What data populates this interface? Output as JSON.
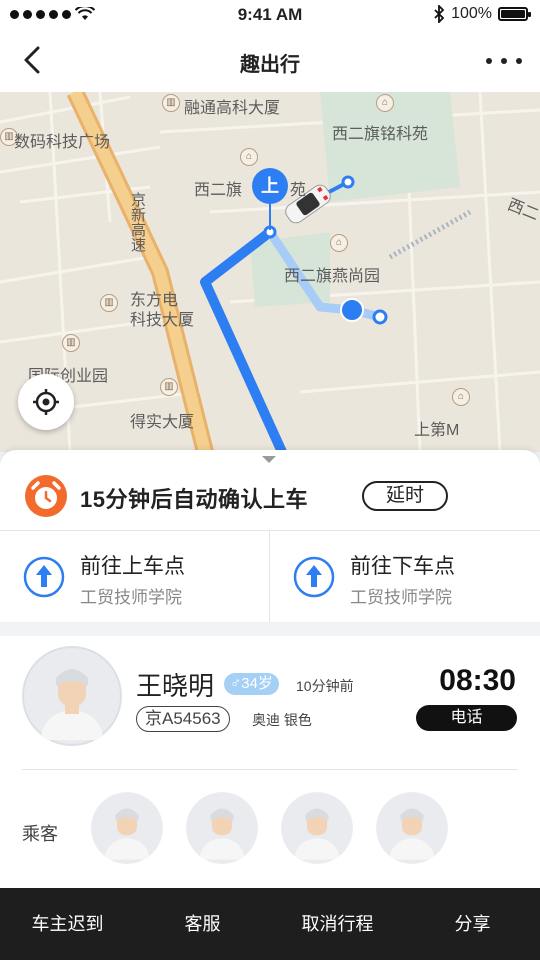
{
  "status_bar": {
    "time": "9:41 AM",
    "battery": "100%",
    "battery_level": 1.0
  },
  "nav": {
    "title": "趣出行"
  },
  "map": {
    "labels": {
      "rongtong": "融通高科大厦",
      "shuma": "数码科技广场",
      "xierqi_mingke": "西二旗铭科苑",
      "xierqi_south": "西二旗",
      "xierqi_short": "苑",
      "jingxin": "京新高速",
      "dongfang1": "东方电",
      "dongfang2": "科技大厦",
      "yanshang": "西二旗燕尚园",
      "guoji": "国际创业园",
      "deshi": "得实大厦",
      "shangdi": "上第M",
      "xierqi_right": "西二"
    },
    "pickup_pin": "上"
  },
  "confirm": {
    "countdown": "15分钟后自动确认上车",
    "delay_label": "延时"
  },
  "pickup": {
    "title": "前往上车点",
    "sub": "工贸技师学院"
  },
  "dropoff": {
    "title": "前往下车点",
    "sub": "工贸技师学院"
  },
  "driver": {
    "name": "王晓明",
    "gender_age": "♂34岁",
    "time_ago": "10分钟前",
    "plate": "京A54563",
    "car": "奥迪 银色",
    "arrive_time": "08:30",
    "call_label": "电话"
  },
  "passengers": {
    "label": "乘客"
  },
  "bottom_bar": [
    {
      "label": "车主迟到"
    },
    {
      "label": "客服"
    },
    {
      "label": "取消行程"
    },
    {
      "label": "分享"
    }
  ],
  "colors": {
    "route": "#2d7ef2",
    "highway": "#e8b26a",
    "alarm": "#f26a2c"
  }
}
